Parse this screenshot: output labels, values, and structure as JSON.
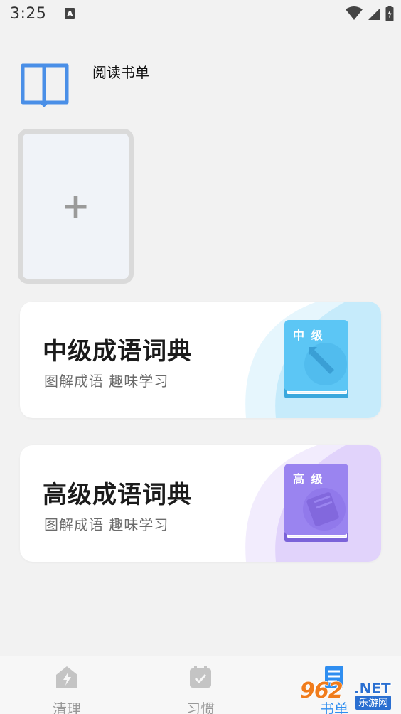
{
  "status_bar": {
    "time": "3:25",
    "notification_icon": "A"
  },
  "section": {
    "title": "阅读书单"
  },
  "add_card": {
    "icon": "+"
  },
  "cards": [
    {
      "title": "中级成语词典",
      "subtitle": "图解成语 趣味学习",
      "cover_label": "中 级",
      "accent": "#5cc6f5"
    },
    {
      "title": "高级成语词典",
      "subtitle": "图解成语 趣味学习",
      "cover_label": "高 级",
      "accent": "#9a84f0"
    }
  ],
  "bottom_nav": {
    "items": [
      {
        "label": "清理",
        "icon": "lightning-house-icon"
      },
      {
        "label": "习惯",
        "icon": "calendar-check-icon"
      },
      {
        "label": "书单",
        "icon": "document-list-icon"
      }
    ]
  },
  "watermark": {
    "logo": "962",
    "domain": ".NET",
    "site_name": "乐游网"
  }
}
